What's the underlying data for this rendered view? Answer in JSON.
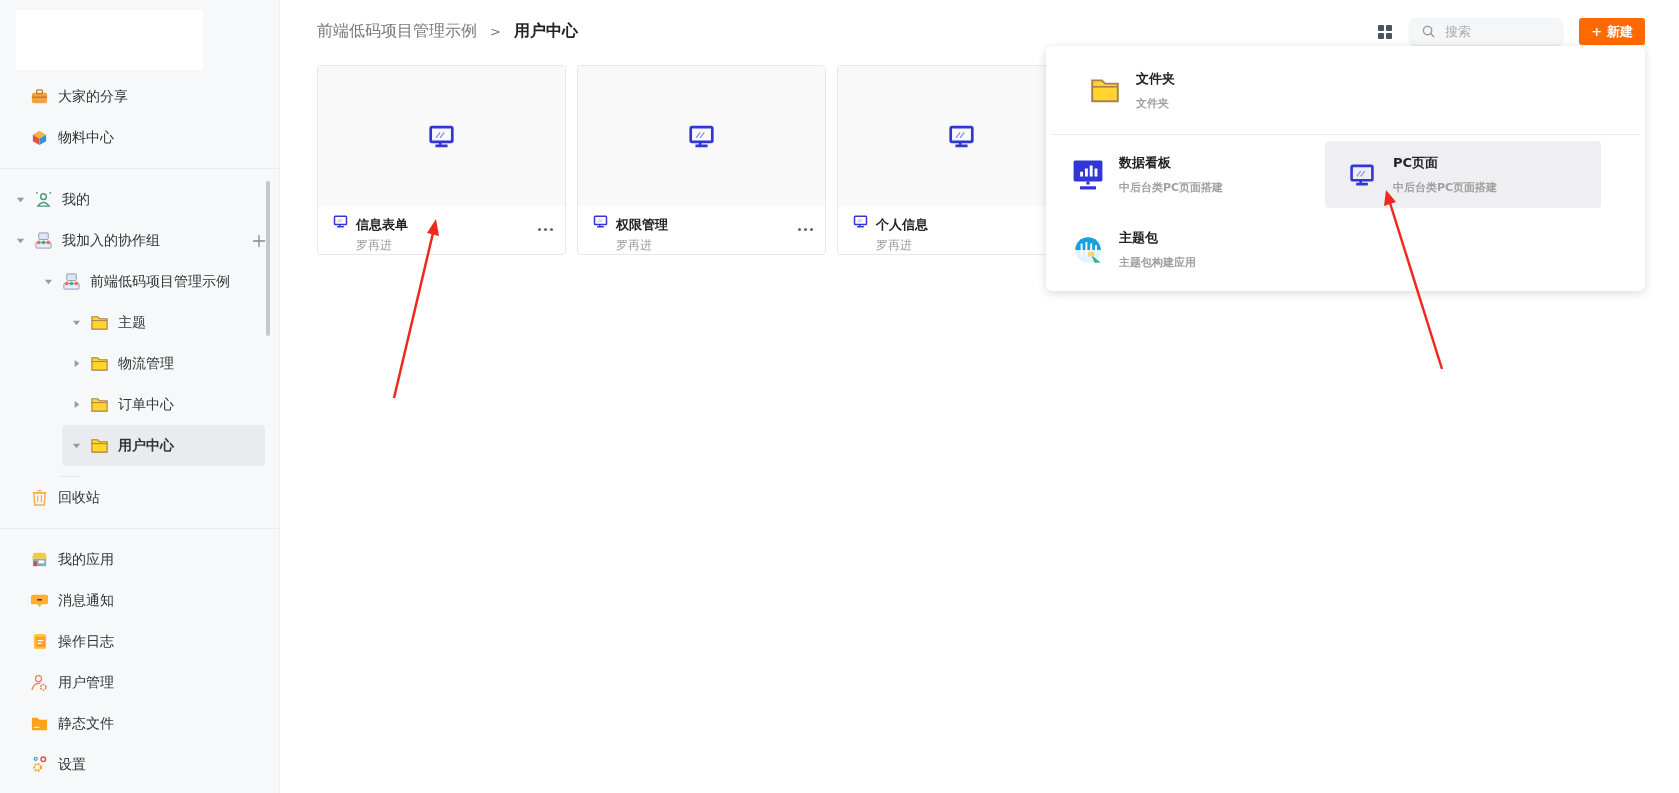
{
  "sidebar": {
    "top_items": [
      {
        "kind": "share",
        "label": "大家的分享",
        "selected": false
      },
      {
        "kind": "material",
        "label": "物料中心",
        "selected": false
      }
    ],
    "tree": [
      {
        "kind": "user",
        "label": "我的",
        "expanded": true,
        "selected": false
      },
      {
        "kind": "group",
        "label": "我加入的协作组",
        "expanded": true,
        "selected": false,
        "add_button": true,
        "children": [
          {
            "kind": "group",
            "label": "前端低码项目管理示例",
            "expanded": true,
            "selected": false,
            "children": [
              {
                "kind": "folder",
                "label": "主题",
                "expanded": true,
                "selected": false
              },
              {
                "kind": "folder",
                "label": "物流管理",
                "expanded": false,
                "selected": false
              },
              {
                "kind": "folder",
                "label": "订单中心",
                "expanded": false,
                "selected": false
              },
              {
                "kind": "folder",
                "label": "用户中心",
                "expanded": true,
                "selected": true
              }
            ]
          }
        ]
      }
    ],
    "trash": {
      "kind": "trash",
      "label": "回收站",
      "selected": false
    },
    "bottom_items": [
      {
        "kind": "apps",
        "label": "我的应用",
        "selected": false
      },
      {
        "kind": "message",
        "label": "消息通知",
        "selected": false
      },
      {
        "kind": "log",
        "label": "操作日志",
        "selected": false
      },
      {
        "kind": "usermgmt",
        "label": "用户管理",
        "selected": false
      },
      {
        "kind": "staticfiles",
        "label": "静态文件",
        "selected": false
      },
      {
        "kind": "settings",
        "label": "设置",
        "selected": false
      }
    ]
  },
  "breadcrumb": {
    "items": [
      {
        "label": "前端低码项目管理示例",
        "current": false
      },
      {
        "label": "用户中心",
        "current": true
      }
    ],
    "separator": ">"
  },
  "toolbar": {
    "search": {
      "placeholder": "搜索"
    },
    "new_button": "+ 新建"
  },
  "cards": [
    {
      "title": "信息表单",
      "author": "罗再进",
      "more": true
    },
    {
      "title": "权限管理",
      "author": "罗再进",
      "more": true
    },
    {
      "title": "个人信息",
      "author": "罗再进",
      "more": false
    }
  ],
  "new_menu": {
    "items": [
      {
        "kind": "folder",
        "title": "文件夹",
        "subtitle": "文件夹",
        "selected": false
      },
      {
        "kind": "dashboard",
        "title": "数据看板",
        "subtitle": "中后台类PC页面搭建",
        "selected": false
      },
      {
        "kind": "pc",
        "title": "PC页面",
        "subtitle": "中后台类PC页面搭建",
        "selected": true
      },
      {
        "kind": "theme",
        "title": "主题包",
        "subtitle": "主题包构建应用",
        "selected": false
      }
    ]
  }
}
